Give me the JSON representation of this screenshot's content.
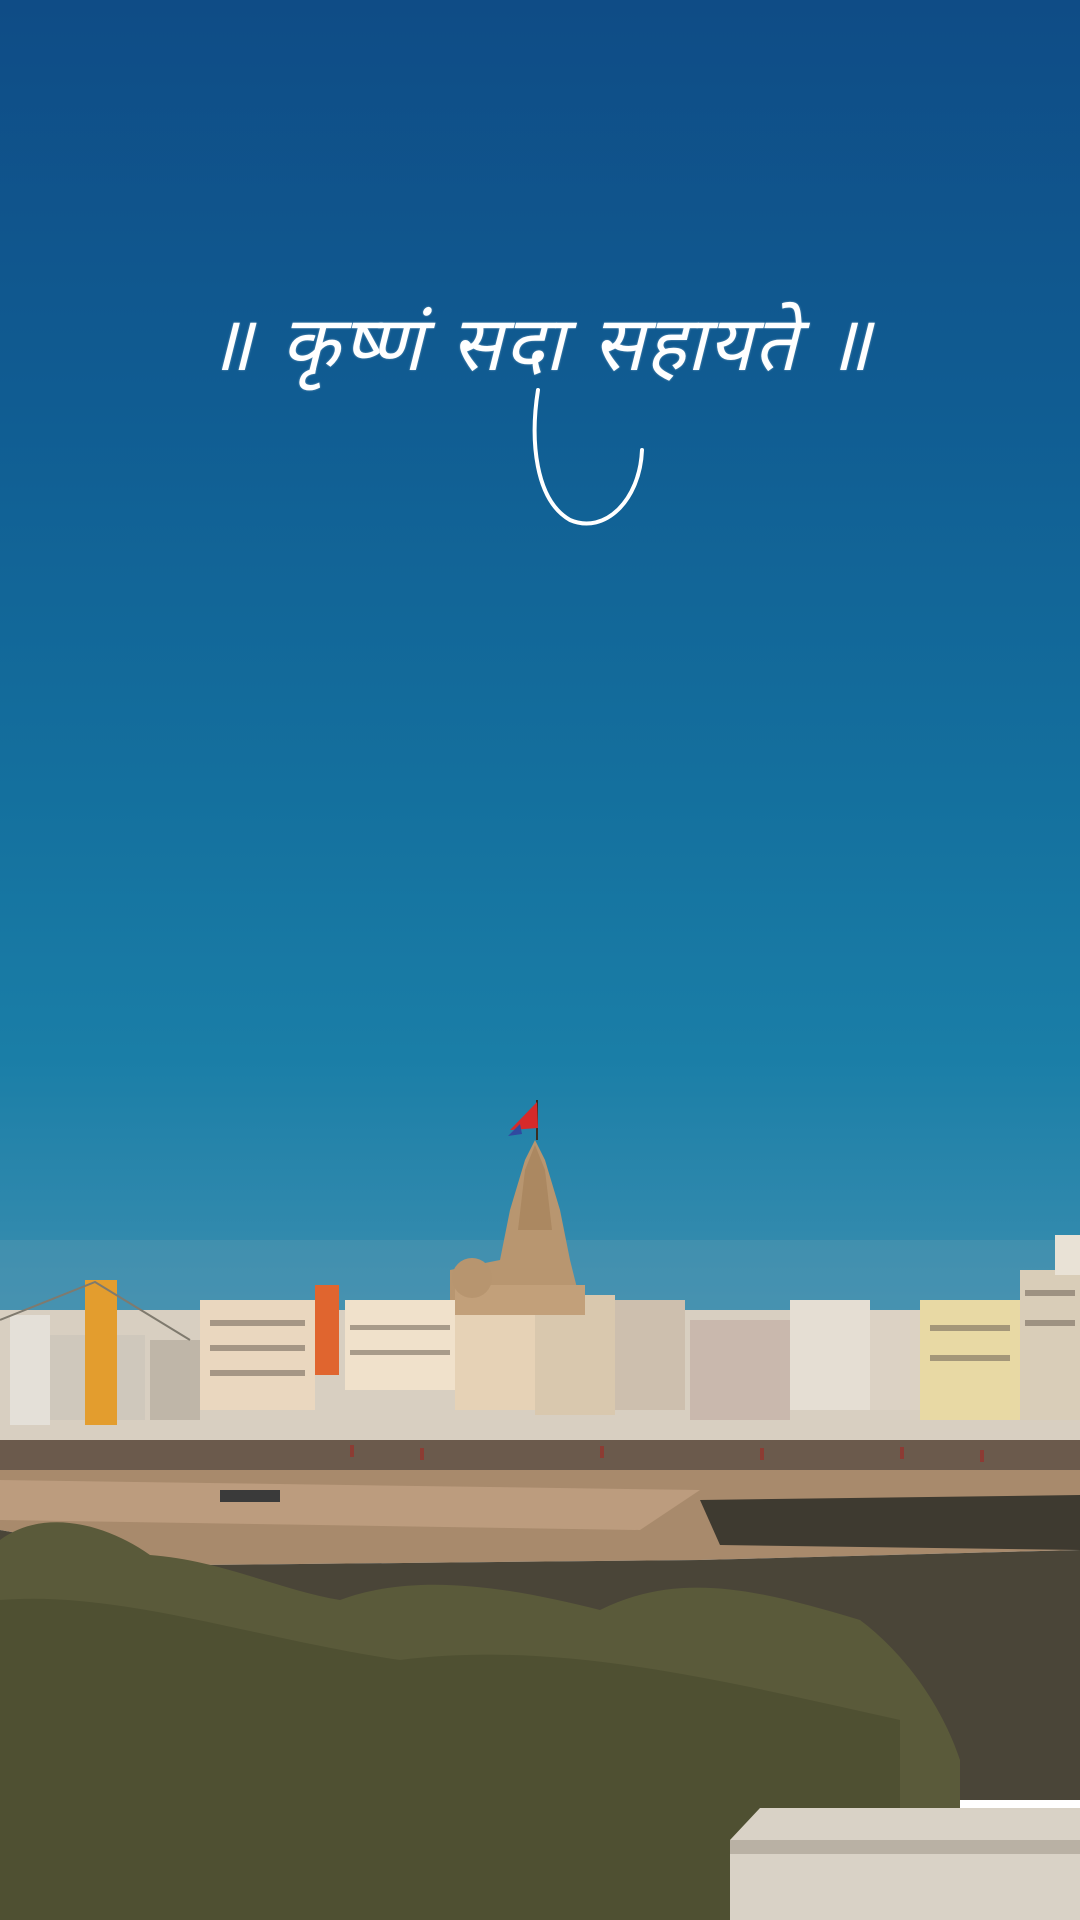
{
  "quote": {
    "text": "॥ कृष्णं सदा सहायते ॥"
  },
  "colors": {
    "sky_top": "#0f4c86",
    "sky_bottom": "#3c8fb0",
    "temple": "#c9a57a",
    "flag": "#d62a2a",
    "water": "#a98a6a",
    "mud": "#4a4538",
    "bushes": "#5a5a3a",
    "ledge": "#d9d2c6"
  }
}
